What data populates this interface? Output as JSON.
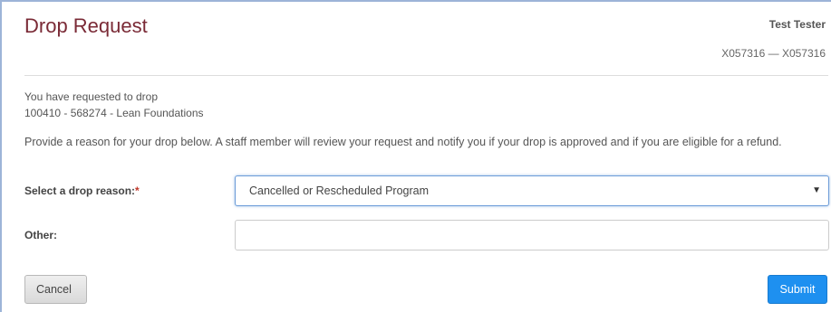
{
  "header": {
    "title": "Drop Request",
    "user_name": "Test Tester",
    "user_ids": "X057316 — X057316"
  },
  "intro": {
    "line1": "You have requested to drop",
    "line2": "100410 - 568274 - Lean Foundations"
  },
  "instructions": "Provide a reason for your drop below. A staff member will review your request and notify you if your drop is approved and if you are eligible for a refund.",
  "form": {
    "reason_label": "Select a drop reason:",
    "required_mark": "*",
    "reason_selected": "Cancelled or Rescheduled Program",
    "other_label": "Other:",
    "other_value": ""
  },
  "buttons": {
    "cancel": "Cancel",
    "submit": "Submit"
  },
  "icons": {
    "dropdown": "caret-down-icon"
  },
  "colors": {
    "title": "#7a2a36",
    "submit": "#1e90f0",
    "required": "#c0392b"
  }
}
